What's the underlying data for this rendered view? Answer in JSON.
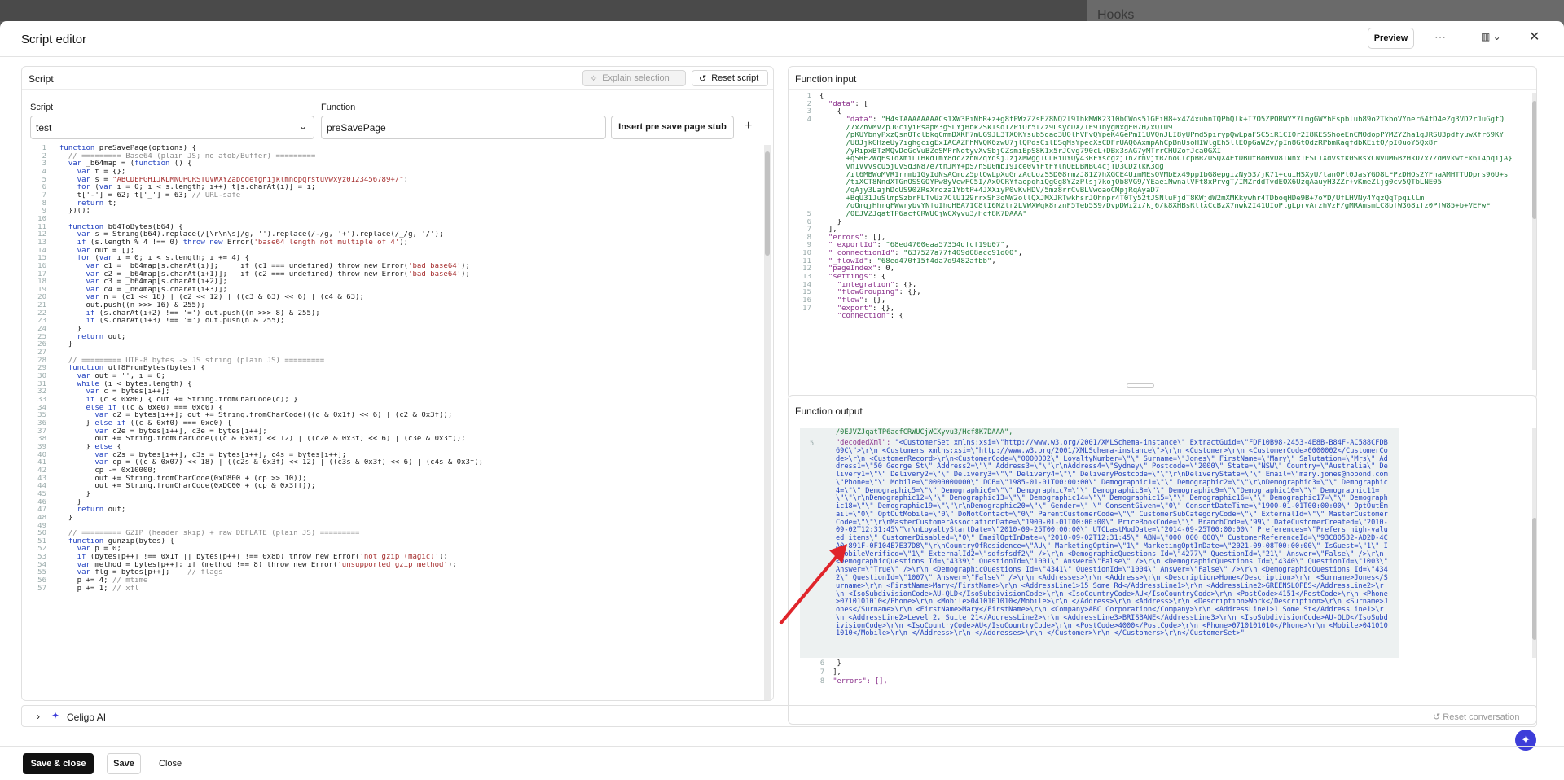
{
  "background": {
    "hooks_title": "Hooks"
  },
  "dialog": {
    "title": "Script editor",
    "preview": "Preview"
  },
  "script_panel": {
    "title": "Script",
    "explain": "Explain selection",
    "reset": "Reset script",
    "script_label": "Script",
    "script_value": "test",
    "function_label": "Function",
    "function_value": "preSavePage",
    "insert_stub": "Insert pre save page stub",
    "add": "+"
  },
  "code_lines": [
    [
      {
        "t": "function ",
        "c": "kw"
      },
      {
        "t": "preSavePage"
      },
      {
        "t": "(options) {"
      }
    ],
    [
      {
        "t": "  // ========= Base64 (plain JS; no atob/Buffer) =========",
        "c": "cm"
      }
    ],
    [
      {
        "t": "  var",
        "c": "kw"
      },
      {
        "t": " _b64map = ("
      },
      {
        "t": "function",
        "c": "kw"
      },
      {
        "t": " () {"
      }
    ],
    [
      {
        "t": "    var",
        "c": "kw"
      },
      {
        "t": " t = {};"
      }
    ],
    [
      {
        "t": "    var",
        "c": "kw"
      },
      {
        "t": " s = "
      },
      {
        "t": "\"ABCDEFGHIJKLMNOPQRSTUVWXYZabcdefghijklmnopqrstuvwxyz0123456789+/\"",
        "c": "st"
      },
      {
        "t": ";"
      }
    ],
    [
      {
        "t": "    for",
        "c": "kw"
      },
      {
        "t": " ("
      },
      {
        "t": "var",
        "c": "kw"
      },
      {
        "t": " i = 0; i < s.length; i++) t[s.charAt(i)] = i;"
      }
    ],
    [
      {
        "t": "    t['-'] = 62; t['_'] = 63; "
      },
      {
        "t": "// URL-safe",
        "c": "cm"
      }
    ],
    [
      {
        "t": "    return",
        "c": "kw"
      },
      {
        "t": " t;"
      }
    ],
    [
      {
        "t": "  })();"
      }
    ],
    [
      {
        "t": ""
      }
    ],
    [
      {
        "t": "  function ",
        "c": "kw"
      },
      {
        "t": "b64ToBytes"
      },
      {
        "t": "(b64) {"
      }
    ],
    [
      {
        "t": "    var",
        "c": "kw"
      },
      {
        "t": " s = String(b64).replace(/[\\r\\n\\s]/g, '').replace(/-/g, '+').replace(/_/g, '/');"
      }
    ],
    [
      {
        "t": "    if",
        "c": "kw"
      },
      {
        "t": " (s.length % 4 !== 0) "
      },
      {
        "t": "throw new",
        "c": "kw"
      },
      {
        "t": " Error("
      },
      {
        "t": "'base64 length not multiple of 4'",
        "c": "st"
      },
      {
        "t": ");"
      }
    ],
    [
      {
        "t": "    var",
        "c": "kw"
      },
      {
        "t": " out = [];"
      }
    ],
    [
      {
        "t": "    for",
        "c": "kw"
      },
      {
        "t": " ("
      },
      {
        "t": "var",
        "c": "kw"
      },
      {
        "t": " i = 0; i < s.length; i += 4) {"
      }
    ],
    [
      {
        "t": "      var",
        "c": "kw"
      },
      {
        "t": " c1 = _b64map[s.charAt(i)];     if (c1 === undefined) throw new Error("
      },
      {
        "t": "'bad base64'",
        "c": "st"
      },
      {
        "t": ");"
      }
    ],
    [
      {
        "t": "      var",
        "c": "kw"
      },
      {
        "t": " c2 = _b64map[s.charAt(i+1)];   if (c2 === undefined) throw new Error("
      },
      {
        "t": "'bad base64'",
        "c": "st"
      },
      {
        "t": ");"
      }
    ],
    [
      {
        "t": "      var",
        "c": "kw"
      },
      {
        "t": " c3 = _b64map[s.charAt(i+2)];"
      }
    ],
    [
      {
        "t": "      var",
        "c": "kw"
      },
      {
        "t": " c4 = _b64map[s.charAt(i+3)];"
      }
    ],
    [
      {
        "t": "      var",
        "c": "kw"
      },
      {
        "t": " n = (c1 << 18) | (c2 << 12) | ((c3 & 63) << 6) | (c4 & 63);"
      }
    ],
    [
      {
        "t": "      out.push((n >>> 16) & 255);"
      }
    ],
    [
      {
        "t": "      if",
        "c": "kw"
      },
      {
        "t": " (s.charAt(i+2) !== '=') out.push((n >>> 8) & 255);"
      }
    ],
    [
      {
        "t": "      if",
        "c": "kw"
      },
      {
        "t": " (s.charAt(i+3) !== '=') out.push(n & 255);"
      }
    ],
    [
      {
        "t": "    }"
      }
    ],
    [
      {
        "t": "    return",
        "c": "kw"
      },
      {
        "t": " out;"
      }
    ],
    [
      {
        "t": "  }"
      }
    ],
    [
      {
        "t": ""
      }
    ],
    [
      {
        "t": "  // ========= UTF-8 bytes -> JS string (plain JS) =========",
        "c": "cm"
      }
    ],
    [
      {
        "t": "  function ",
        "c": "kw"
      },
      {
        "t": "utf8FromBytes"
      },
      {
        "t": "(bytes) {"
      }
    ],
    [
      {
        "t": "    var",
        "c": "kw"
      },
      {
        "t": " out = '', i = 0;"
      }
    ],
    [
      {
        "t": "    while",
        "c": "kw"
      },
      {
        "t": " (i < bytes.length) {"
      }
    ],
    [
      {
        "t": "      var",
        "c": "kw"
      },
      {
        "t": " c = bytes[i++];"
      }
    ],
    [
      {
        "t": "      if",
        "c": "kw"
      },
      {
        "t": " (c < 0x80) { out += String.fromCharCode(c); }"
      }
    ],
    [
      {
        "t": "      else if",
        "c": "kw"
      },
      {
        "t": " ((c & 0xe0) === 0xc0) {"
      }
    ],
    [
      {
        "t": "        var",
        "c": "kw"
      },
      {
        "t": " c2 = bytes[i++]; out += String.fromCharCode(((c & 0x1f) << 6) | (c2 & 0x3f));"
      }
    ],
    [
      {
        "t": "      } "
      },
      {
        "t": "else if",
        "c": "kw"
      },
      {
        "t": " ((c & 0xf0) === 0xe0) {"
      }
    ],
    [
      {
        "t": "        var",
        "c": "kw"
      },
      {
        "t": " c2e = bytes[i++], c3e = bytes[i++];"
      }
    ],
    [
      {
        "t": "        out += String.fromCharCode(((c & 0x0f) << 12) | ((c2e & 0x3f) << 6) | (c3e & 0x3f));"
      }
    ],
    [
      {
        "t": "      } "
      },
      {
        "t": "else",
        "c": "kw"
      },
      {
        "t": " {"
      }
    ],
    [
      {
        "t": "        var",
        "c": "kw"
      },
      {
        "t": " c2s = bytes[i++], c3s = bytes[i++], c4s = bytes[i++];"
      }
    ],
    [
      {
        "t": "        var",
        "c": "kw"
      },
      {
        "t": " cp = ((c & 0x07) << 18) | ((c2s & 0x3f) << 12) | ((c3s & 0x3f) << 6) | (c4s & 0x3f);"
      }
    ],
    [
      {
        "t": "        cp -= 0x10000;"
      }
    ],
    [
      {
        "t": "        out += String.fromCharCode(0xD800 + (cp >> 10));"
      }
    ],
    [
      {
        "t": "        out += String.fromCharCode(0xDC00 + (cp & 0x3ff));"
      }
    ],
    [
      {
        "t": "      }"
      }
    ],
    [
      {
        "t": "    }"
      }
    ],
    [
      {
        "t": "    return",
        "c": "kw"
      },
      {
        "t": " out;"
      }
    ],
    [
      {
        "t": "  }"
      }
    ],
    [
      {
        "t": ""
      }
    ],
    [
      {
        "t": "  // ========= GZIP (header skip) + raw DEFLATE (plain JS) =========",
        "c": "cm"
      }
    ],
    [
      {
        "t": "  function ",
        "c": "kw"
      },
      {
        "t": "gunzip"
      },
      {
        "t": "(bytes) {"
      }
    ],
    [
      {
        "t": "    var",
        "c": "kw"
      },
      {
        "t": " p = 0;"
      }
    ],
    [
      {
        "t": "    if",
        "c": "kw"
      },
      {
        "t": " (bytes[p++] !== 0x1f || bytes[p++] !== 0x8b) throw new Error("
      },
      {
        "t": "'not gzip (magic)'",
        "c": "st"
      },
      {
        "t": ");"
      }
    ],
    [
      {
        "t": "    var",
        "c": "kw"
      },
      {
        "t": " method = bytes[p++]; if (method !== 8) throw new Error("
      },
      {
        "t": "'unsupported gzip method'",
        "c": "st"
      },
      {
        "t": ");"
      }
    ],
    [
      {
        "t": "    var",
        "c": "kw"
      },
      {
        "t": " flg = bytes[p++];    "
      },
      {
        "t": "// flags",
        "c": "cm"
      }
    ],
    [
      {
        "t": "    p += 4; "
      },
      {
        "t": "// mtime",
        "c": "cm"
      }
    ],
    [
      {
        "t": "    p += 1; "
      },
      {
        "t": "// xfl",
        "c": "cm"
      }
    ]
  ],
  "input_panel": {
    "title": "Function input"
  },
  "input_lines": [
    [
      {
        "t": "{"
      }
    ],
    [
      {
        "t": "  "
      },
      {
        "t": "\"data\"",
        "c": "ky"
      },
      {
        "t": ": ["
      }
    ],
    [
      {
        "t": "    {"
      }
    ],
    [
      {
        "t": "      "
      },
      {
        "t": "\"data\"",
        "c": "ky"
      },
      {
        "t": ": "
      },
      {
        "t": "\"H4sIAAAAAAAACs1XW3PiNhR+z+g8fPWzZZsEZ8NQ2l9IhkMWK2310bCWos51GEiH8+x4Z4xubnTQPbQlk+I7O5ZPORWYY7LmgGWYhFspblub89o2TkboVYner64fD4eZg3VD2rJuGgfQ",
        "c": "nm"
      }
    ],
    [
      {
        "t": "      /7xZhvMVZpJGciyiPsapM3gSLYjHbk2SkTsdTZPiOr5lZz9LsycDX/IE91bygNxgE07H/xQlU9",
        "c": "nm"
      }
    ],
    [
      {
        "t": "      /pKUYbnyPxzQsnOTclbkgCmmDXKF7mUG9JL3TXOKYsub5qao3U0lhVFvQYpeK4GePmI1UVQnJLI8yUPmd5pirypQwLpaFSC5iR1CI0r2I8KESShoeEnCMOdopPYMZYZha1gJRSU3pdfyuwXfr69KY",
        "c": "nm"
      }
    ],
    [
      {
        "t": "      /U8JjkGHzeUy7ighgcigExIACAZFhMVQK6zwU7jlQPdsCilESqMsYpecXsCDFrUAQ6AxmpAhCpBnUsoHIWlgEh5llE0pGaWZv/pIn8GtOdzRPbmKaqfdbKEitO/pI0uoY5Qx8r",
        "c": "nm"
      }
    ],
    [
      {
        "t": "      /yRipxBTzMQvDeGcVuBZeSMPrNotyvXvSbjCZsmiEpS8K1x5rJCvg790cL+DBx3sAG7yMTrrCHUZofJca0GXI",
        "c": "nm"
      }
    ],
    [
      {
        "t": "      +qSRF2WqEsTdXmiLlHkdImY8dcZzhNZqYqsjJzjXMwgg1CLRiuYQy43RFYscgzjIh2rnVjtRZnoClcpBRZ0SQX4EtDBUtBoHvD8TNnx1ESL1Xdvsfk0SRsxCNvuMGBzHkD7x7ZdMVkwtFk6T4pqijA}",
        "c": "nm"
      }
    ],
    [
      {
        "t": "      vn1VVvscU5jUvSd3N87e7tnJMY+pS/nSD0mbI9Ice0vYFtFYlhQEDBNBC4cjTD3CDzlkK3dg",
        "c": "nm"
      }
    ],
    [
      {
        "t": "      /il6MBWoMVR1rrmb1GyIdNsACmdz5plOwLpXuGnzAcUozSSD08rmzJ81Z7hXGCE4UimMEsOVMbEx49ppIbG8epgizNy53/jK71+cuiHSXyU/tan0Pl0JasYGD8LFPzDHOs2YFnaAMHTTUDprs96U+s",
        "c": "nm"
      }
    ],
    [
      {
        "t": "      /tiXCT8NndXTGnOSSGOYPw8yVewFC5I/AxOCRYfaopqhiQgGg8YZzPlsj7kojOb8VG9/YEaeiNwnalVFt8xPrvgT/IMZrddTvdEOX6UzqAauyH3ZZr+vKmeZljg0cv5QTbLNE05",
        "c": "nm"
      }
    ],
    [
      {
        "t": "      /qAjy3LajhDcUS90ZRsXrqza1YbtP+4JXXiyP0vKvHDV/5mz8rrCvBLVwoaoCMpjRqAyaD7",
        "c": "nm"
      }
    ],
    [
      {
        "t": "      +BqU31JuSlmpSzbrFLTvUz7ClU129rrxSh3qNW2ollQXJMXJRTwkhsrJOhnpr4T0Ty52tJSNluFjdT8KWjdW2mXMKkywhr4TDboqHDe9B+7oYD/UfLHVNy4YqzQqTpqilLm",
        "c": "nm"
      }
    ],
    [
      {
        "t": "      /oQmqjHhrqFWwrybvYNfoIhoHBA71C8lI6NZlr2LVWXWqk8rznF5Teb5S9/DvpDWi2i/kj6/k8XHBsRllxCcBzX7nwk2I41UIoPlgLprvArzhVzF/gMRAmsmLC8bfW368ifz0PfW85+b+VEFwF",
        "c": "nm"
      }
    ],
    [
      {
        "t": "      /0EJVZJqatTP6acfCRWUCjWCXyvu3/Hcf8K7DAAA\"",
        "c": "nm"
      }
    ],
    [
      {
        "t": "    }"
      }
    ],
    [
      {
        "t": "  ],"
      }
    ],
    [
      {
        "t": "  "
      },
      {
        "t": "\"errors\"",
        "c": "ky"
      },
      {
        "t": ": [],"
      }
    ],
    [
      {
        "t": "  "
      },
      {
        "t": "\"_exportId\"",
        "c": "ky"
      },
      {
        "t": ": "
      },
      {
        "t": "\"68ed4700eaa57354dfcf19b07\"",
        "c": "nm"
      },
      {
        "t": ","
      }
    ],
    [
      {
        "t": "  "
      },
      {
        "t": "\"_connectionId\"",
        "c": "ky"
      },
      {
        "t": ": "
      },
      {
        "t": "\"637527a77f409d08acc91d00\"",
        "c": "nm"
      },
      {
        "t": ","
      }
    ],
    [
      {
        "t": "  "
      },
      {
        "t": "\"_flowId\"",
        "c": "ky"
      },
      {
        "t": ": "
      },
      {
        "t": "\"68ed470f15f4da7d9482afbb\"",
        "c": "nm"
      },
      {
        "t": ","
      }
    ],
    [
      {
        "t": "  "
      },
      {
        "t": "\"pageIndex\"",
        "c": "ky"
      },
      {
        "t": ": 0,"
      }
    ],
    [
      {
        "t": "  "
      },
      {
        "t": "\"settings\"",
        "c": "ky"
      },
      {
        "t": ": {"
      }
    ],
    [
      {
        "t": "    "
      },
      {
        "t": "\"integration\"",
        "c": "ky"
      },
      {
        "t": ": {},"
      }
    ],
    [
      {
        "t": "    "
      },
      {
        "t": "\"flowGrouping\"",
        "c": "ky"
      },
      {
        "t": ": {},"
      }
    ],
    [
      {
        "t": "    "
      },
      {
        "t": "\"flow\"",
        "c": "ky"
      },
      {
        "t": ": {},"
      }
    ],
    [
      {
        "t": "    "
      },
      {
        "t": "\"export\"",
        "c": "ky"
      },
      {
        "t": ": {},"
      }
    ],
    [
      {
        "t": "    "
      },
      {
        "t": "\"connection\"",
        "c": "ky"
      },
      {
        "t": ": {"
      }
    ]
  ],
  "input_gutter": [
    "1",
    "2",
    "3",
    "4",
    "",
    "",
    "",
    "",
    "",
    "",
    "",
    "",
    "",
    "",
    "",
    "5",
    "6",
    "7",
    "8",
    "9",
    "10",
    "11",
    "12",
    "13",
    "14",
    "15",
    "16",
    "17"
  ],
  "output_panel": {
    "title": "Function output",
    "first_line": "/0EJVZJqatTP6acfCRWUCjWCXyvu3/Hcf8K7DAAA\",",
    "decoded_key": "\"decodedXml\":",
    "decoded_value": "\"<CustomerSet xmlns:xsi=\\\"http://www.w3.org/2001/XMLSchema-instance\\\" ExtractGuid=\\\"FDF10B98-2453-4E8B-B84F-AC588CFDB69C\\\">\\r\\n  <Customers xmlns:xsi=\\\"http://www.w3.org/2001/XMLSchema-instance\\\">\\r\\n    <Customer>\\r\\n      <CustomerCode>0000002</CustomerCode>\\r\\n      <CustomerRecord>\\r\\n<CustomerCode=\\\"0000002\\\" LoyaltyNumber=\\\"\\\" Surname=\\\"Jones\\\" FirstName=\\\"Mary\\\" Salutation=\\\"Mrs\\\" Address1=\\\"50 George St\\\" Address2=\\\"\\\" Address3=\\\"\\\"\\r\\nAddress4=\\\"Sydney\\\" Postcode=\\\"2000\\\" State=\\\"NSW\\\" Country=\\\"Australia\\\" Delivery1=\\\"\\\" Delivery2=\\\"\\\" Delivery3=\\\"\\\" Delivery4=\\\"\\\" DeliveryPostcode=\\\"\\\"\\r\\nDeliveryState=\\\"\\\" Email=\\\"mary.jones@nopond.com\\\"Phone=\\\"\\\" Mobile=\\\"0000000000\\\" DOB=\\\"1985-01-01T00:00:00\\\" Demographic1=\\\"\\\" Demographic2=\\\"\\\"\\r\\nDemographic3=\\\"\\\" Demographic4=\\\"\\\" Demographic5=\\\"\\\" Demographic6=\\\"\\\" Demographic7=\\\"\\\" Demographic8=\\\"\\\" Demographic9=\\\"\\\"Demographic10=\\\"\\\" Demographic11=\\\"\\\"\\r\\nDemographic12=\\\"\\\" Demographic13=\\\"\\\" Demographic14=\\\"\\\" Demographic15=\\\"\\\" Demographic16=\\\"\\\" Demographic17=\\\"\\\" Demographic18=\\\"\\\" Demographic19=\\\"\\\"\\r\\nDemographic20=\\\"\\\" Gender=\\\" \\\" ConsentGiven=\\\"0\\\" ConsentDateTime=\\\"1900-01-01T00:00:00\\\" OptOutEmail=\\\"0\\\" OptOutMobile=\\\"0\\\" DoNotContact=\\\"0\\\" ParentCustomerCode=\\\"\\\" CustomerSubCategoryCode=\\\"\\\" ExternalId=\\\"\\\" MasterCustomerCode=\\\"\\\"\\r\\nMasterCustomerAssociationDate=\\\"1900-01-01T00:00:00\\\" PriceBookCode=\\\"\\\" BranchCode=\\\"99\\\" DateCustomerCreated=\\\"2010-09-02T12:31:45\\\"\\r\\nLoyaltyStartDate=\\\"2010-09-25T00:00:00\\\" UTCLastModDate=\\\"2014-09-25T00:00:00\\\" Preferences=\\\"Prefers high-valued items\\\" CustomerDisabled=\\\"0\\\" EmailOptInDate=\\\"2010-09-02T12:31:45\\\" ABN=\\\"000 000 000\\\" CustomerReferenceId=\\\"93C80532-AD2D-4CA0-891F-0F104E7E37D8\\\"\\r\\nCountryOfResidence=\\\"AU\\\" MarketingOptin=\\\"1\\\" MarketingOptInDate=\\\"2021-09-08T00:00:00\\\" IsGuest=\\\"1\\\" IsMobileVerified=\\\"1\\\" ExternalId2=\\\"sdfsfsdf2\\\" />\\r\\n      <DemographicQuestions Id=\\\"4277\\\" QuestionId=\\\"21\\\" Answer=\\\"False\\\" />\\r\\n      <DemographicQuestions Id=\\\"4339\\\" QuestionId=\\\"1001\\\" Answer=\\\"False\\\" />\\r\\n      <DemographicQuestions Id=\\\"4340\\\" QuestionId=\\\"1003\\\" Answer=\\\"True\\\" />\\r\\n      <DemographicQuestions Id=\\\"4341\\\" QuestionId=\\\"1004\\\" Answer=\\\"False\\\" />\\r\\n      <DemographicQuestions Id=\\\"4342\\\" QuestionId=\\\"1007\\\" Answer=\\\"False\\\" />\\r\\n      <Addresses>\\r\\n        <Address>\\r\\n          <Description>Home</Description>\\r\\n          <Surname>Jones</Surname>\\r\\n          <FirstName>Mary</FirstName>\\r\\n          <AddressLine1>15 Some Rd</AddressLine1>\\r\\n          <AddressLine2>GREENSLOPES</AddressLine2>\\r\\n          <IsoSubdivisionCode>AU-QLD</IsoSubdivisionCode>\\r\\n          <IsoCountryCode>AU</IsoCountryCode>\\r\\n          <PostCode>4151</PostCode>\\r\\n          <Phone>0710101010</Phone>\\r\\n          <Mobile>0410101010</Mobile>\\r\\n        </Address>\\r\\n        <Address>\\r\\n          <Description>Work</Description>\\r\\n          <Surname>Jones</Surname>\\r\\n          <FirstName>Mary</FirstName>\\r\\n          <Company>ABC Corporation</Company>\\r\\n          <AddressLine1>1 Some St</AddressLine1>\\r\\n          <AddressLine2>Level 2, Suite 21</AddressLine2>\\r\\n          <AddressLine3>BRISBANE</AddressLine3>\\r\\n          <IsoSubdivisionCode>AU-QLD</IsoSubdivisionCode>\\r\\n          <IsoCountryCode>AU</IsoCountryCode>\\r\\n          <PostCode>4000</PostCode>\\r\\n          <Phone>0710101010</Phone>\\r\\n          <Mobile>0410101010</Mobile>\\r\\n        </Address>\\r\\n      </Addresses>\\r\\n    </Customer>\\r\\n  </Customers>\\r\\n</CustomerSet>\"",
    "tail_lines": [
      "}",
      "],",
      "\"errors\": [],"
    ],
    "gutter": {
      "decoded": "5",
      "tail": [
        "6",
        "7",
        "8"
      ]
    }
  },
  "celigo_ai": {
    "label": "Celigo AI",
    "reset": "Reset conversation"
  },
  "footer": {
    "save_close": "Save & close",
    "save": "Save",
    "close": "Close"
  },
  "colors": {
    "accent": "#3d3dd9",
    "annotation_arrow": "#e0242a"
  }
}
